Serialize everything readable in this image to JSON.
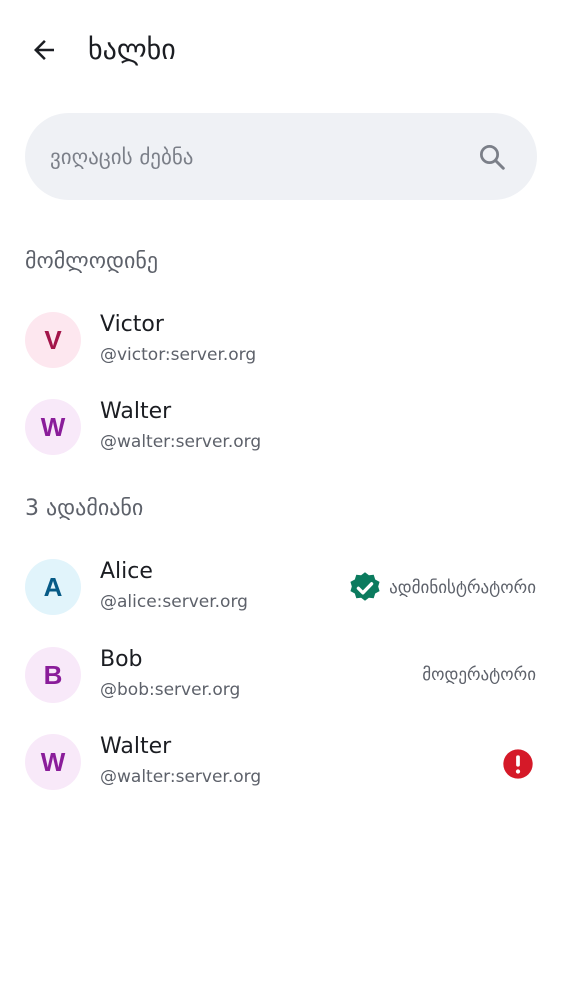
{
  "header": {
    "title": "ხალხი",
    "back_icon": "arrow-left-icon"
  },
  "search": {
    "placeholder": "ვიღაცის ძებნა",
    "value": "",
    "icon": "search-icon"
  },
  "pending": {
    "heading": "მომლოდინე",
    "members": [
      {
        "initial": "V",
        "name": "Victor",
        "handle": "@victor:server.org",
        "avatar_bg": "#fde7ef",
        "avatar_fg": "#a3154a"
      },
      {
        "initial": "W",
        "name": "Walter",
        "handle": "@walter:server.org",
        "avatar_bg": "#f8e9f9",
        "avatar_fg": "#8a1d9a"
      }
    ]
  },
  "joined": {
    "heading": "3 ადამიანი",
    "members": [
      {
        "initial": "A",
        "name": "Alice",
        "handle": "@alice:server.org",
        "avatar_bg": "#e1f4fb",
        "avatar_fg": "#065a86",
        "role": "ადმინისტრატორი",
        "role_icon": "verified-badge-icon"
      },
      {
        "initial": "B",
        "name": "Bob",
        "handle": "@bob:server.org",
        "avatar_bg": "#f8e9f9",
        "avatar_fg": "#8a1d9a",
        "role": "მოდერატორი"
      },
      {
        "initial": "W",
        "name": "Walter",
        "handle": "@walter:server.org",
        "avatar_bg": "#f8e9f9",
        "avatar_fg": "#8a1d9a",
        "status_icon": "error-icon"
      }
    ]
  },
  "colors": {
    "verified": "#0b7b5e",
    "error": "#d51928",
    "muted_text": "#5d616a",
    "search_bg": "#eff1f5"
  }
}
